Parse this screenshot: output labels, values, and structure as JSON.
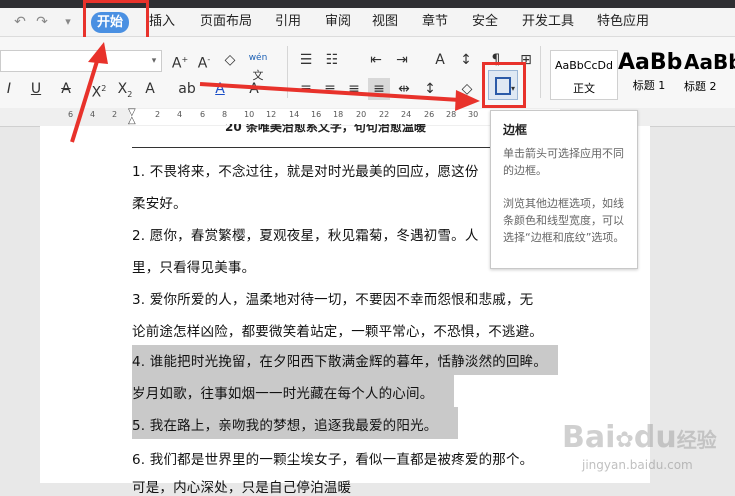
{
  "quick_access": {
    "undo": "↶",
    "redo": "↷",
    "more": "▾"
  },
  "tabs": {
    "home": "开始",
    "insert": "插入",
    "layout": "页面布局",
    "references": "引用",
    "review": "审阅",
    "view": "视图",
    "chapter": "章节",
    "security": "安全",
    "developer": "开发工具",
    "special": "特色应用"
  },
  "ribbon": {
    "font_name": "",
    "pinyin": "wén",
    "styles": [
      {
        "preview": "AaBbCcDd",
        "label": "正文"
      },
      {
        "preview": "AaBb",
        "label": "标题 1"
      },
      {
        "preview": "AaBb",
        "label": "标题 2"
      }
    ]
  },
  "ruler": {
    "numbers": [
      "6",
      "4",
      "2",
      "2",
      "4",
      "6",
      "8",
      "10",
      "12",
      "14",
      "16",
      "18",
      "20",
      "22",
      "24",
      "26",
      "28",
      "30",
      "32"
    ]
  },
  "document": {
    "title_partial": "20 条唯美治愈系文字，句句治愈温暖",
    "lines": [
      "1. 不畏将来，不念过往，就是对时光最美的回应，愿这份",
      "柔安好。",
      "2. 愿你，春赏繁樱，夏观夜星，秋见霜菊，冬遇初雪。人",
      "里，只看得见美事。",
      "3. 爱你所爱的人，温柔地对待一切，不要因不幸而怨恨和悲戚，无",
      "论前途怎样凶险，都要微笑着站定，一颗平常心，不恐惧，不逃避。",
      "4. 谁能把时光挽留，在夕阳西下散满金辉的暮年，恬静淡然的回眸。",
      "岁月如歌，往事如烟一一时光藏在每个人的心间。",
      "5. 我在路上，亲吻我的梦想，追逐我最爱的阳光。",
      "6. 我们都是世界里的一颗尘埃女子，看似一直都是被疼爱的那个。",
      "可是，内心深处，只是自己停泊温暖"
    ]
  },
  "tooltip": {
    "title": "边框",
    "desc1": "单击箭头可选择应用不同的边框。",
    "desc2": "浏览其他边框选项，如线条颜色和线型宽度，可以选择“边框和底纹”选项。"
  },
  "watermark": {
    "brand": "Bai",
    "paw": "du",
    "jingyan": "经验",
    "url": "jingyan.baidu.com"
  },
  "colors": {
    "accent": "#4a90e2",
    "annotation_red": "#e8322b",
    "highlight": "#c9c9c9"
  }
}
